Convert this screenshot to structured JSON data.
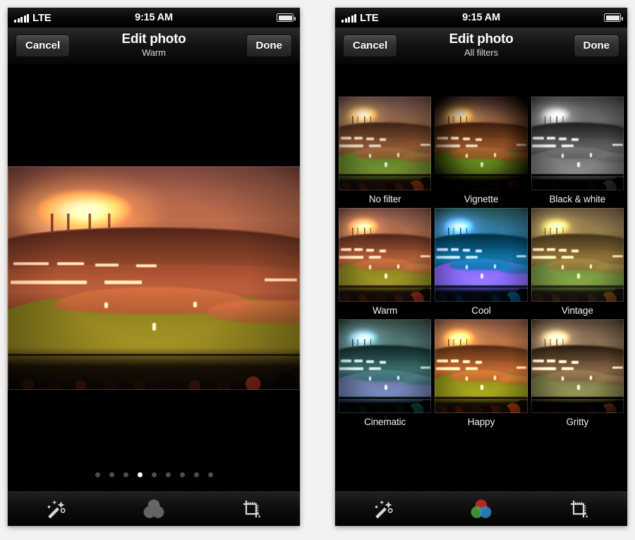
{
  "meta": {
    "background_color": "#f3f2f0",
    "screen_background": "#000000",
    "accent_white": "#ffffff"
  },
  "status_bar": {
    "carrier": "LTE",
    "signal_bars": 5,
    "time": "9:15 AM",
    "battery_icon": "battery-full-icon"
  },
  "phones": [
    {
      "id": "edit-photo-single",
      "nav": {
        "cancel_label": "Cancel",
        "title": "Edit photo",
        "subtitle": "Warm",
        "done_label": "Done"
      },
      "pager": {
        "total": 9,
        "active_index": 3
      },
      "toolbar": {
        "items": [
          {
            "icon": "magic-wand-icon",
            "label": "Enhance",
            "active": false
          },
          {
            "icon": "filters-circles-icon",
            "label": "Filters",
            "active": false
          },
          {
            "icon": "crop-icon",
            "label": "Crop",
            "active": false
          }
        ]
      }
    },
    {
      "id": "edit-photo-all-filters",
      "nav": {
        "cancel_label": "Cancel",
        "title": "Edit photo",
        "subtitle": "All filters",
        "done_label": "Done"
      },
      "filters": [
        {
          "name": "No filter",
          "style": "f-none"
        },
        {
          "name": "Vignette",
          "style": "f-vig"
        },
        {
          "name": "Black & white",
          "style": "f-bw"
        },
        {
          "name": "Warm",
          "style": "f-warm"
        },
        {
          "name": "Cool",
          "style": "f-cool"
        },
        {
          "name": "Vintage",
          "style": "f-vintage"
        },
        {
          "name": "Cinematic",
          "style": "f-cinema"
        },
        {
          "name": "Happy",
          "style": "f-happy"
        },
        {
          "name": "Gritty",
          "style": "f-gritty"
        }
      ],
      "toolbar": {
        "items": [
          {
            "icon": "magic-wand-icon",
            "label": "Enhance",
            "active": false
          },
          {
            "icon": "filters-circles-icon",
            "label": "Filters",
            "active": true
          },
          {
            "icon": "crop-icon",
            "label": "Crop",
            "active": false
          }
        ]
      }
    }
  ],
  "photo": {
    "subject": "baseball-stadium-at-dusk",
    "applied_filter": "Warm"
  },
  "icon_colors": {
    "filters_active_red": "#cc2a2a",
    "filters_active_green": "#4caf3f",
    "filters_active_blue": "#2f8fd4",
    "inactive_gray": "#8a8a8a"
  }
}
